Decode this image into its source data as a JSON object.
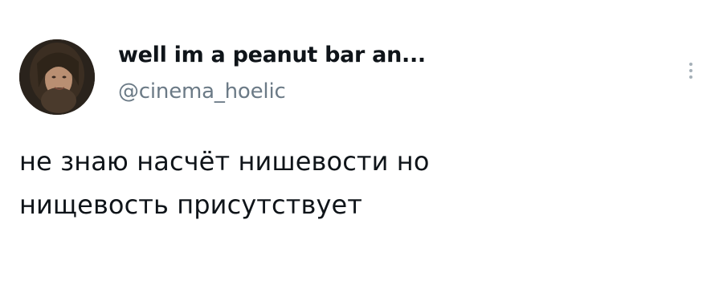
{
  "tweet": {
    "author": {
      "display_name": "well im a peanut bar an...",
      "handle": "@cinema_hoelic",
      "avatar_icon": "user-avatar-photo"
    },
    "text_lines": [
      "не знаю насчёт нишевости но",
      "нищевость присутствует"
    ],
    "more_icon": "more-options-icon"
  },
  "colors": {
    "text": "#0f1419",
    "secondary": "#6b7a86",
    "background": "#ffffff"
  }
}
